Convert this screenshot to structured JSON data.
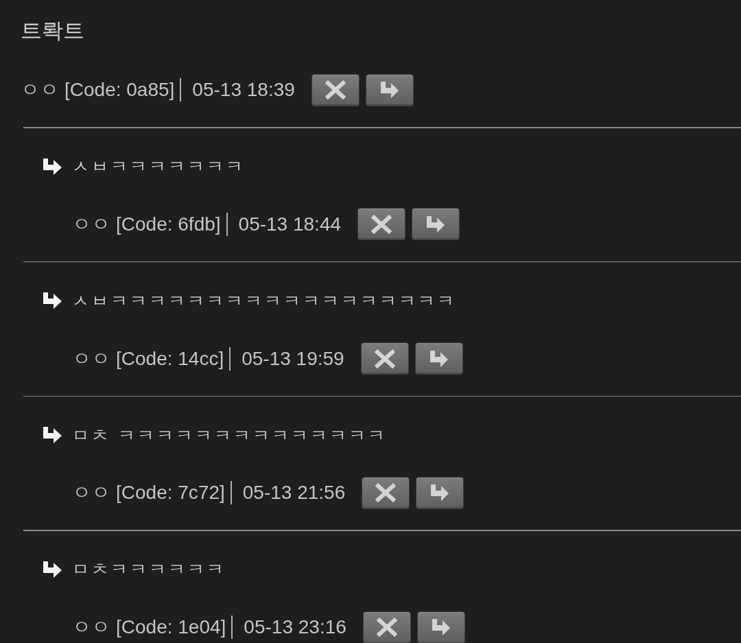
{
  "title": "트롹트",
  "comment": {
    "author": "ㅇㅇ",
    "code": "[Code: 0a85]",
    "date": "05-13 18:39",
    "actions": [
      {
        "kind": "delete"
      },
      {
        "kind": "reply"
      }
    ]
  },
  "replies": [
    {
      "text": "ㅅㅂㅋㅋㅋㅋㅋㅋㅋ",
      "author": "ㅇㅇ",
      "code": "[Code: 6fdb]",
      "date": "05-13 18:44",
      "actions": [
        {
          "kind": "delete"
        },
        {
          "kind": "reply"
        }
      ]
    },
    {
      "text": "ㅅㅂㅋㅋㅋㅋㅋㅋㅋㅋㅋㅋㅋㅋㅋㅋㅋㅋㅋㅋ",
      "author": "ㅇㅇ",
      "code": "[Code: 14cc]",
      "date": "05-13 19:59",
      "actions": [
        {
          "kind": "delete"
        },
        {
          "kind": "reply"
        }
      ]
    },
    {
      "text": "ㅁㅊ ㅋㅋㅋㅋㅋㅋㅋㅋㅋㅋㅋㅋㅋㅋ",
      "author": "ㅇㅇ",
      "code": "[Code: 7c72]",
      "date": "05-13 21:56",
      "actions": [
        {
          "kind": "delete"
        },
        {
          "kind": "reply"
        }
      ]
    },
    {
      "text": "ㅁㅊㅋㅋㅋㅋㅋㅋ",
      "author": "ㅇㅇ",
      "code": "[Code: 1e04]",
      "date": "05-13 23:16",
      "actions": [
        {
          "kind": "delete"
        },
        {
          "kind": "reply"
        }
      ]
    }
  ]
}
